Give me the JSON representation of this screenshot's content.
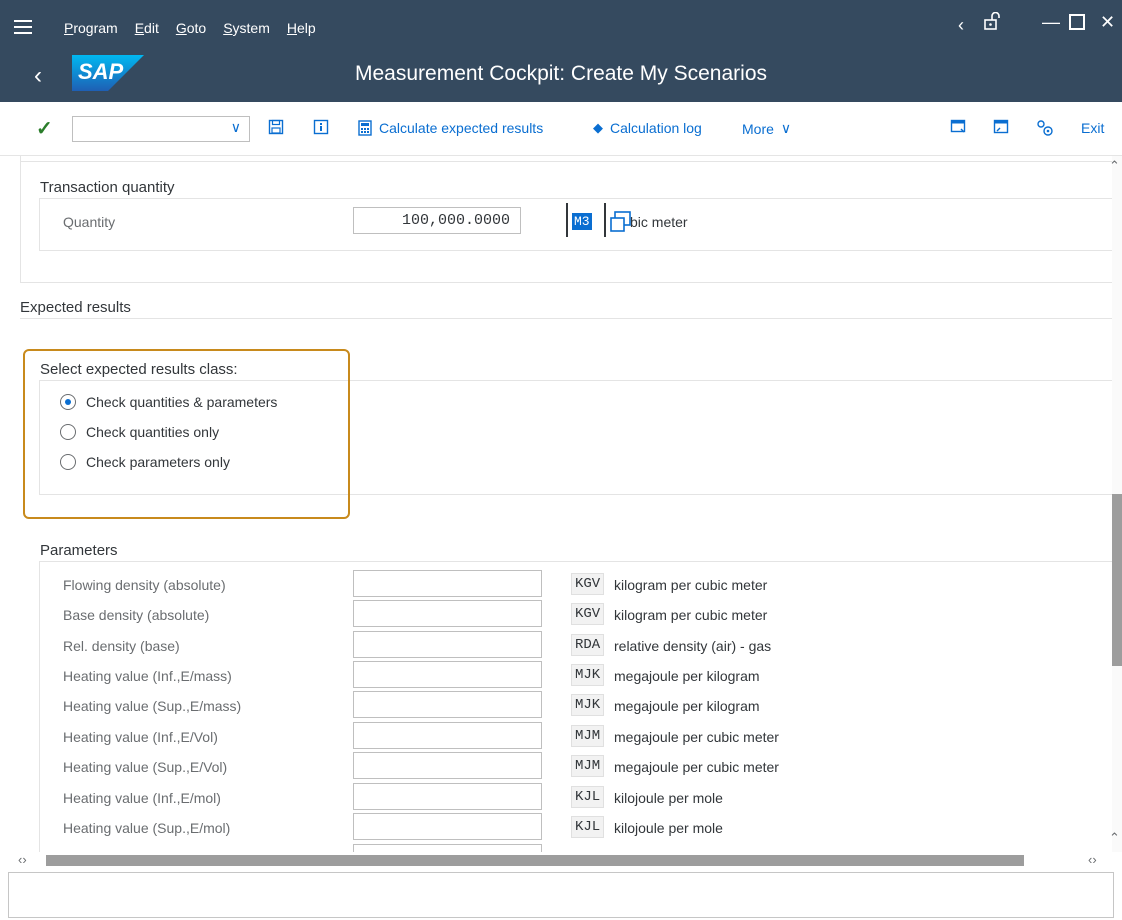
{
  "menu": {
    "items": [
      "Program",
      "Edit",
      "Goto",
      "System",
      "Help"
    ]
  },
  "window": {
    "title": "Measurement Cockpit: Create My Scenarios",
    "logo_text": "SAP"
  },
  "toolbar": {
    "combo_value": "",
    "calculate_label": "Calculate expected results",
    "calc_log_label": "Calculation log",
    "more_label": "More",
    "exit_label": "Exit"
  },
  "transaction_quantity": {
    "heading": "Transaction quantity",
    "quantity_label": "Quantity",
    "quantity_value": "100,000.0000",
    "unit_code": "M3",
    "unit_text": "bic meter"
  },
  "expected_results": {
    "heading": "Expected results",
    "class_heading": "Select expected results class:",
    "options": [
      {
        "label": "Check quantities & parameters",
        "selected": true
      },
      {
        "label": "Check quantities only",
        "selected": false
      },
      {
        "label": "Check parameters only",
        "selected": false
      }
    ]
  },
  "parameters": {
    "heading": "Parameters",
    "rows": [
      {
        "label": "Flowing density (absolute)",
        "value": "",
        "unit_code": "KGV",
        "unit_text": "kilogram per cubic meter"
      },
      {
        "label": "Base  density (absolute)",
        "value": "",
        "unit_code": "KGV",
        "unit_text": "kilogram per cubic meter"
      },
      {
        "label": "Rel. density (base)",
        "value": "",
        "unit_code": "RDA",
        "unit_text": "relative density (air) - gas"
      },
      {
        "label": "Heating value (Inf.,E/mass)",
        "value": "",
        "unit_code": "MJK",
        "unit_text": "megajoule per kilogram"
      },
      {
        "label": "Heating value (Sup.,E/mass)",
        "value": "",
        "unit_code": "MJK",
        "unit_text": "megajoule per kilogram"
      },
      {
        "label": "Heating value (Inf.,E/Vol)",
        "value": "",
        "unit_code": "MJM",
        "unit_text": "megajoule per cubic meter"
      },
      {
        "label": "Heating value (Sup.,E/Vol)",
        "value": "",
        "unit_code": "MJM",
        "unit_text": "megajoule per cubic meter"
      },
      {
        "label": "Heating value (Inf.,E/mol)",
        "value": "",
        "unit_code": "KJL",
        "unit_text": "kilojoule per mole"
      },
      {
        "label": "Heating value (Sup.,E/mol)",
        "value": "",
        "unit_code": "KJL",
        "unit_text": "kilojoule per mole"
      }
    ]
  },
  "status": {
    "message": ""
  },
  "colors": {
    "shell": "#354a5f",
    "accent": "#0a6ed1",
    "highlight": "#c88a1c",
    "check": "#2b7d2b"
  }
}
